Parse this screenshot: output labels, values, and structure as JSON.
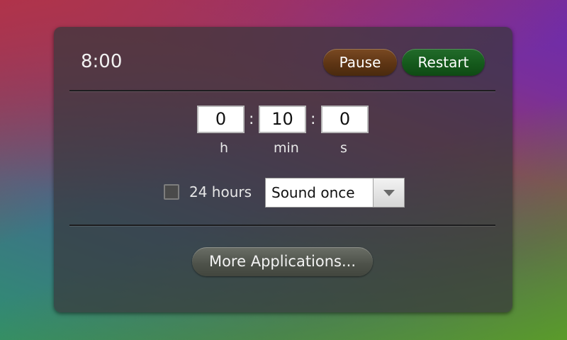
{
  "timer": {
    "display": "8:00"
  },
  "buttons": {
    "pause_label": "Pause",
    "restart_label": "Restart",
    "more_label": "More Applications..."
  },
  "time_fields": {
    "hours": "0",
    "minutes": "10",
    "seconds": "0",
    "hours_unit": "h",
    "minutes_unit": "min",
    "seconds_unit": "s",
    "separator": ":"
  },
  "options": {
    "checkbox_label": "24 hours",
    "checkbox_checked": false,
    "sound_select_value": "Sound once"
  },
  "colors": {
    "pause_button": "#5e3514",
    "restart_button": "#155a1c"
  }
}
